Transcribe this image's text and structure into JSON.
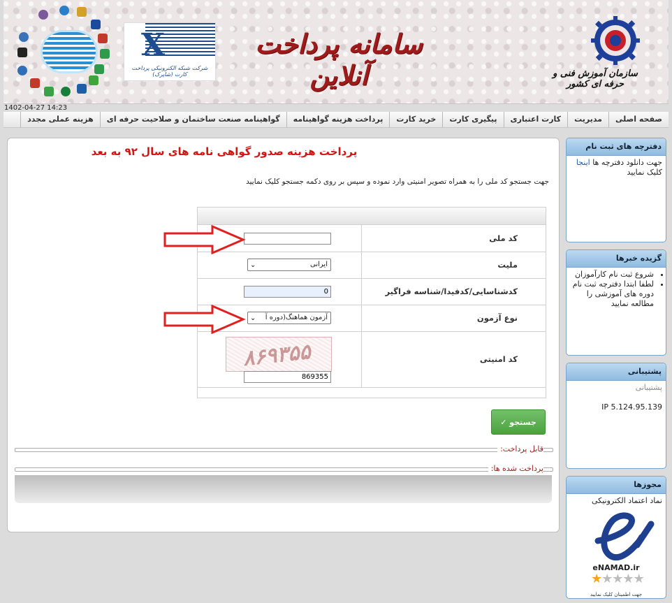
{
  "header": {
    "site_title": "سامانه پرداخت آنلاین",
    "org_name": "سازمان آموزش فنی و حرفه ای کشور",
    "shaparak_caption": "شرکت شبکه الکترونیکی پرداخت کارت (شاپرک)",
    "datetime": "1402-04-27 14:23"
  },
  "nav": {
    "items": [
      "صفحه اصلی",
      "مدیریت",
      "کارت اعتباری",
      "پیگیری کارت",
      "خرید کارت",
      "پرداخت هزینه گواهینامه",
      "گواهینامه صنعت ساختمان و صلاحیت حرفه ای",
      "هزینه عملی مجدد"
    ]
  },
  "main": {
    "title": "پرداخت هزینه صدور گواهی نامه های سال ۹۲ به بعد",
    "instruction": "جهت جستجو کد ملی را به همراه تصویر امنیتی وارد نموده و سپس بر روی دکمه جستجو کلیک نمایید",
    "form": {
      "national_code_label": "کد ملی",
      "national_code_value": "",
      "nationality_label": "ملیت",
      "nationality_value": "ایرانی",
      "id_label": "کدشناسایی/کدفیدا/شناسه فراگیر",
      "id_value": "0",
      "exam_type_label": "نوع آزمون",
      "exam_type_value": "آزمون هماهنگ(دوره آ",
      "captcha_label": "کد امنیتی",
      "captcha_image_text": "۸۶۹۳۵۵",
      "captcha_value": "869355"
    },
    "search_button": "جستجو ✓",
    "payable_label": "قابل پرداخت:",
    "paid_label": "پرداخت شده ها:"
  },
  "sidebar": {
    "registry": {
      "title": "دفترچه های ثبت نام",
      "text_before": "جهت دانلود دفترچه ها",
      "link": "اینجا",
      "text_after": "کلیک نمایید"
    },
    "news": {
      "title": "گزیده خبرها",
      "items": [
        "شروع ثبت نام کارآموزان",
        "لطفا ابتدا دفترچه ثبت نام دوره های آموزشی را مطالعه نمایید"
      ]
    },
    "support": {
      "title": "پشتیبانی",
      "link": "پشتیبانی",
      "ip": "IP 5.124.95.139"
    },
    "licenses": {
      "title": "مجوزها",
      "text": "نماد اعتماد الکترونیکی",
      "enamad_label": "eNAMAD.ir",
      "enamad_footer": "جهت اطمینان کلیک نمایید",
      "stars": 1,
      "stars_total": 5
    }
  },
  "colors": {
    "title_red": "#d11414",
    "brand_maroon": "#9e1b1b",
    "search_green": "#4aa23e",
    "sidebar_blue": "#8fbbe0",
    "arrow_red": "#e02020"
  }
}
